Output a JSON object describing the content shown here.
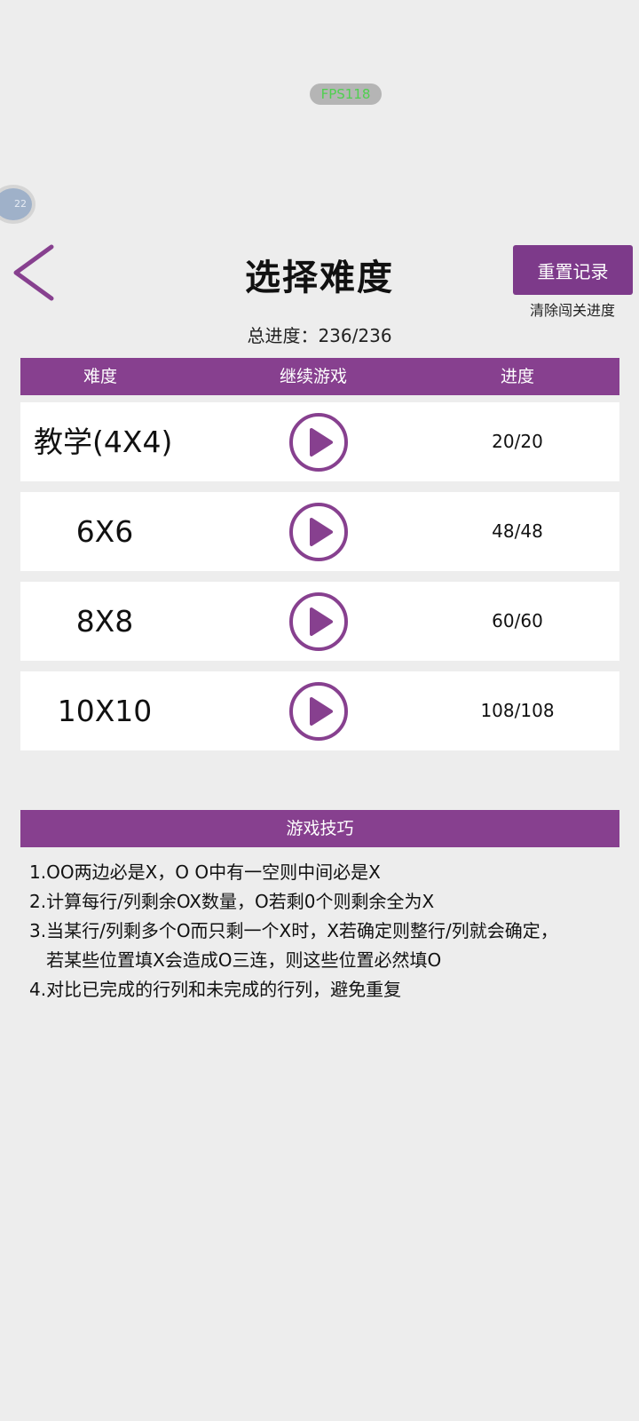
{
  "overlay": {
    "fps": "FPS118",
    "ball_text": "22"
  },
  "header": {
    "title": "选择难度",
    "reset_label": "重置记录",
    "reset_hint": "清除闯关进度",
    "total_progress": "总进度：236/236"
  },
  "table": {
    "columns": [
      "难度",
      "继续游戏",
      "进度"
    ],
    "rows": [
      {
        "name": "教学(4X4)",
        "progress": "20/20"
      },
      {
        "name": "6X6",
        "progress": "48/48"
      },
      {
        "name": "8X8",
        "progress": "60/60"
      },
      {
        "name": "10X10",
        "progress": "108/108"
      }
    ]
  },
  "tips": {
    "title": "游戏技巧",
    "items": [
      "1.OO两边必是X，O O中有一空则中间必是X",
      "2.计算每行/列剩余OX数量，O若剩0个则剩余全为X",
      "3.当某行/列剩多个O而只剩一个X时，X若确定则整行/列就会确定，",
      "   若某些位置填X会造成O三连，则这些位置必然填O",
      "4.对比已完成的行列和未完成的行列，避免重复"
    ]
  },
  "colors": {
    "accent": "#87408f",
    "background": "#ededed",
    "fps_text": "#4fd04f"
  },
  "icons": {
    "back": "chevron-left-icon",
    "play": "play-circle-icon"
  }
}
